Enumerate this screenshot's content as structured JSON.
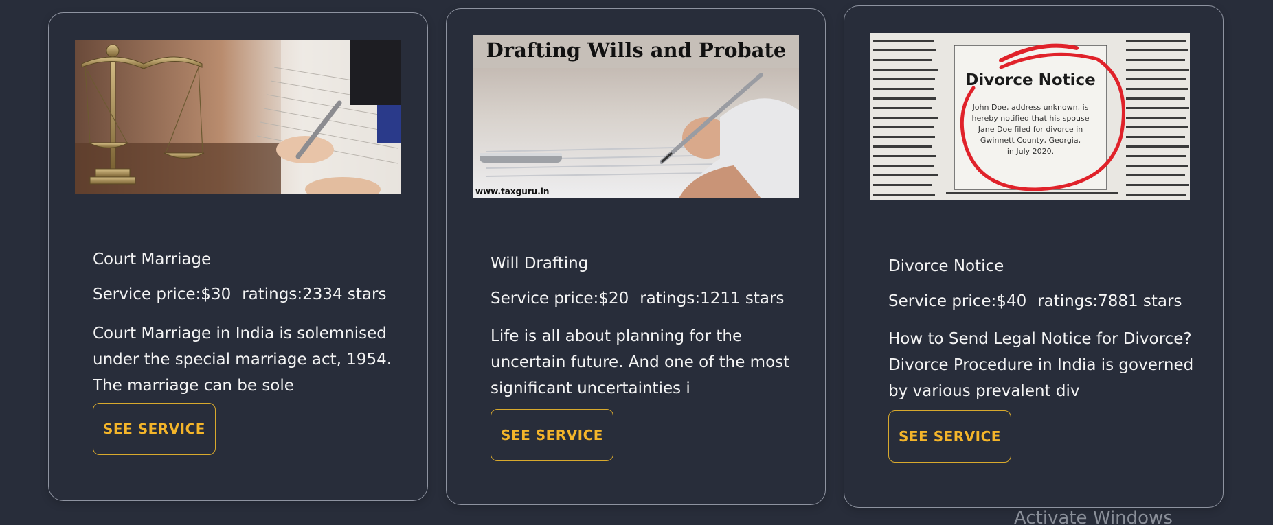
{
  "cards": [
    {
      "image_alt": "scales of justice and signing document",
      "title": "Court Marriage",
      "price": "Service price:$30",
      "ratings": "ratings:2334 stars",
      "description": "Court Marriage in India is solemnised under the special marriage act, 1954. The marriage can be sole",
      "button_label": "SEE SERVICE"
    },
    {
      "image_alt": "hand signing a will with pen",
      "image_heading": "Drafting Wills and Probate",
      "image_footer": "www.taxguru.in",
      "title": "Will Drafting",
      "price": "Service price:$20",
      "ratings": "ratings:1211 stars",
      "description": "Life is all about planning for the uncertain future. And one of the most significant uncertainties i",
      "button_label": "SEE SERVICE"
    },
    {
      "image_alt": "newspaper divorce notice circled in red",
      "image_heading": "Divorce Notice",
      "image_body": [
        "John Doe, address unknown, is",
        "hereby notified that his spouse",
        "Jane Doe filed for divorce in",
        "Gwinnett County, Georgia,",
        "in July 2020."
      ],
      "title": "Divorce Notice",
      "price": "Service price:$40",
      "ratings": "ratings:7881 stars",
      "description": "How to Send Legal Notice for Divorce?Divorce Procedure in India is governed by various prevalent div",
      "button_label": "SEE SERVICE"
    }
  ],
  "watermark": "Activate Windows",
  "colors": {
    "background": "#282d3a",
    "card_border": "#8e93a0",
    "accent": "#f4b52a",
    "text": "#f4f4f4"
  }
}
